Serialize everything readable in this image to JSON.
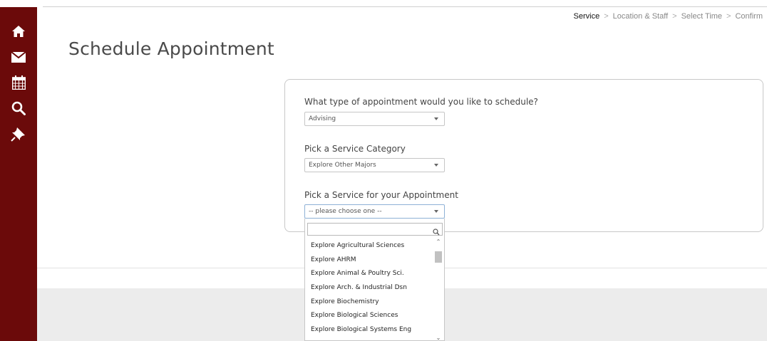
{
  "page": {
    "title": "Schedule Appointment"
  },
  "breadcrumb": [
    {
      "label": "Service",
      "active": true
    },
    {
      "label": "Location & Staff",
      "active": false
    },
    {
      "label": "Select Time",
      "active": false
    },
    {
      "label": "Confirm",
      "active": false
    }
  ],
  "sidebar": {
    "items": [
      {
        "icon": "home-icon"
      },
      {
        "icon": "envelope-icon"
      },
      {
        "icon": "calendar-icon"
      },
      {
        "icon": "search-icon"
      },
      {
        "icon": "thumbtack-icon"
      }
    ]
  },
  "form": {
    "q1": {
      "label": "What type of appointment would you like to schedule?",
      "value": "Advising"
    },
    "q2": {
      "label": "Pick a Service Category",
      "value": "Explore Other Majors"
    },
    "q3": {
      "label": "Pick a Service for your Appointment",
      "value": "-- please choose one --"
    }
  },
  "dropdown": {
    "search_value": "",
    "options": [
      "Explore Agricultural Sciences",
      "Explore AHRM",
      "Explore Animal & Poultry Sci.",
      "Explore Arch. & Industrial Dsn",
      "Explore Biochemistry",
      "Explore Biological Sciences",
      "Explore Biological Systems Eng"
    ]
  },
  "colors": {
    "sidebar": "#6b0a0a",
    "accent_border": "#8eb1d6",
    "title_text": "#4a4a4a"
  }
}
